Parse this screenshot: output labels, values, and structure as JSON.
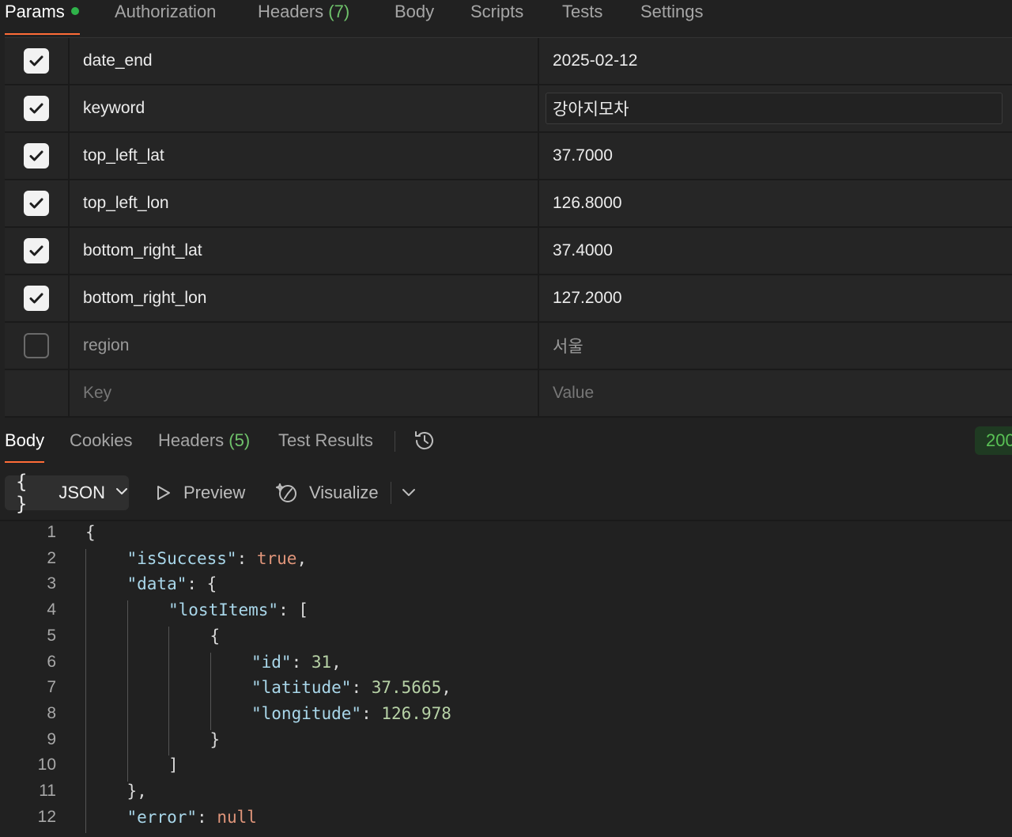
{
  "request_tabs": [
    {
      "label": "Params",
      "count": "",
      "active": true,
      "dot": true
    },
    {
      "label": "Authorization",
      "count": "",
      "active": false
    },
    {
      "label": "Headers",
      "count": "(7)",
      "active": false
    },
    {
      "label": "Body",
      "count": "",
      "active": false
    },
    {
      "label": "Scripts",
      "count": "",
      "active": false
    },
    {
      "label": "Tests",
      "count": "",
      "active": false
    },
    {
      "label": "Settings",
      "count": "",
      "active": false
    }
  ],
  "params": {
    "rows": [
      {
        "checked": true,
        "key": "date_end",
        "value": "2025-02-12"
      },
      {
        "checked": true,
        "key": "keyword",
        "value": "강아지모차",
        "editing": true
      },
      {
        "checked": true,
        "key": "top_left_lat",
        "value": "37.7000"
      },
      {
        "checked": true,
        "key": "top_left_lon",
        "value": "126.8000"
      },
      {
        "checked": true,
        "key": "bottom_right_lat",
        "value": "37.4000"
      },
      {
        "checked": true,
        "key": "bottom_right_lon",
        "value": "127.2000"
      },
      {
        "checked": false,
        "key": "region",
        "value": "서울"
      }
    ],
    "new_row": {
      "key_placeholder": "Key",
      "value_placeholder": "Value"
    }
  },
  "response_tabs": [
    {
      "label": "Body",
      "count": "",
      "active": true
    },
    {
      "label": "Cookies",
      "count": "",
      "active": false
    },
    {
      "label": "Headers",
      "count": "(5)",
      "active": false
    },
    {
      "label": "Test Results",
      "count": "",
      "active": false
    }
  ],
  "status": {
    "code_text": "200",
    "color": "#59c255"
  },
  "toolbar": {
    "format_braces": "{ }",
    "format_label": "JSON",
    "preview_label": "Preview",
    "visualize_label": "Visualize"
  },
  "code_lines": [
    {
      "n": "1",
      "indent": 0,
      "tokens": [
        {
          "t": "{",
          "c": "punc"
        }
      ]
    },
    {
      "n": "2",
      "indent": 1,
      "tokens": [
        {
          "t": "\"isSuccess\"",
          "c": "key"
        },
        {
          "t": ": ",
          "c": "punc"
        },
        {
          "t": "true",
          "c": "bool"
        },
        {
          "t": ",",
          "c": "punc"
        }
      ]
    },
    {
      "n": "3",
      "indent": 1,
      "tokens": [
        {
          "t": "\"data\"",
          "c": "key"
        },
        {
          "t": ": {",
          "c": "punc"
        }
      ]
    },
    {
      "n": "4",
      "indent": 2,
      "tokens": [
        {
          "t": "\"lostItems\"",
          "c": "key"
        },
        {
          "t": ": [",
          "c": "punc"
        }
      ]
    },
    {
      "n": "5",
      "indent": 3,
      "tokens": [
        {
          "t": "{",
          "c": "punc"
        }
      ]
    },
    {
      "n": "6",
      "indent": 4,
      "tokens": [
        {
          "t": "\"id\"",
          "c": "key"
        },
        {
          "t": ": ",
          "c": "punc"
        },
        {
          "t": "31",
          "c": "num"
        },
        {
          "t": ",",
          "c": "punc"
        }
      ]
    },
    {
      "n": "7",
      "indent": 4,
      "tokens": [
        {
          "t": "\"latitude\"",
          "c": "key"
        },
        {
          "t": ": ",
          "c": "punc"
        },
        {
          "t": "37.5665",
          "c": "num"
        },
        {
          "t": ",",
          "c": "punc"
        }
      ]
    },
    {
      "n": "8",
      "indent": 4,
      "tokens": [
        {
          "t": "\"longitude\"",
          "c": "key"
        },
        {
          "t": ": ",
          "c": "punc"
        },
        {
          "t": "126.978",
          "c": "num"
        }
      ]
    },
    {
      "n": "9",
      "indent": 3,
      "tokens": [
        {
          "t": "}",
          "c": "punc"
        }
      ]
    },
    {
      "n": "10",
      "indent": 2,
      "tokens": [
        {
          "t": "]",
          "c": "punc"
        }
      ]
    },
    {
      "n": "11",
      "indent": 1,
      "tokens": [
        {
          "t": "},",
          "c": "punc"
        }
      ]
    },
    {
      "n": "12",
      "indent": 1,
      "tokens": [
        {
          "t": "\"error\"",
          "c": "key"
        },
        {
          "t": ": ",
          "c": "punc"
        },
        {
          "t": "null",
          "c": "null"
        }
      ]
    }
  ],
  "colors": {
    "accent": "#ff6c37",
    "count_green": "#6fc26b",
    "json_key": "#a9d7ea",
    "json_bool_null": "#e0957a",
    "json_number": "#b7d2a6"
  }
}
